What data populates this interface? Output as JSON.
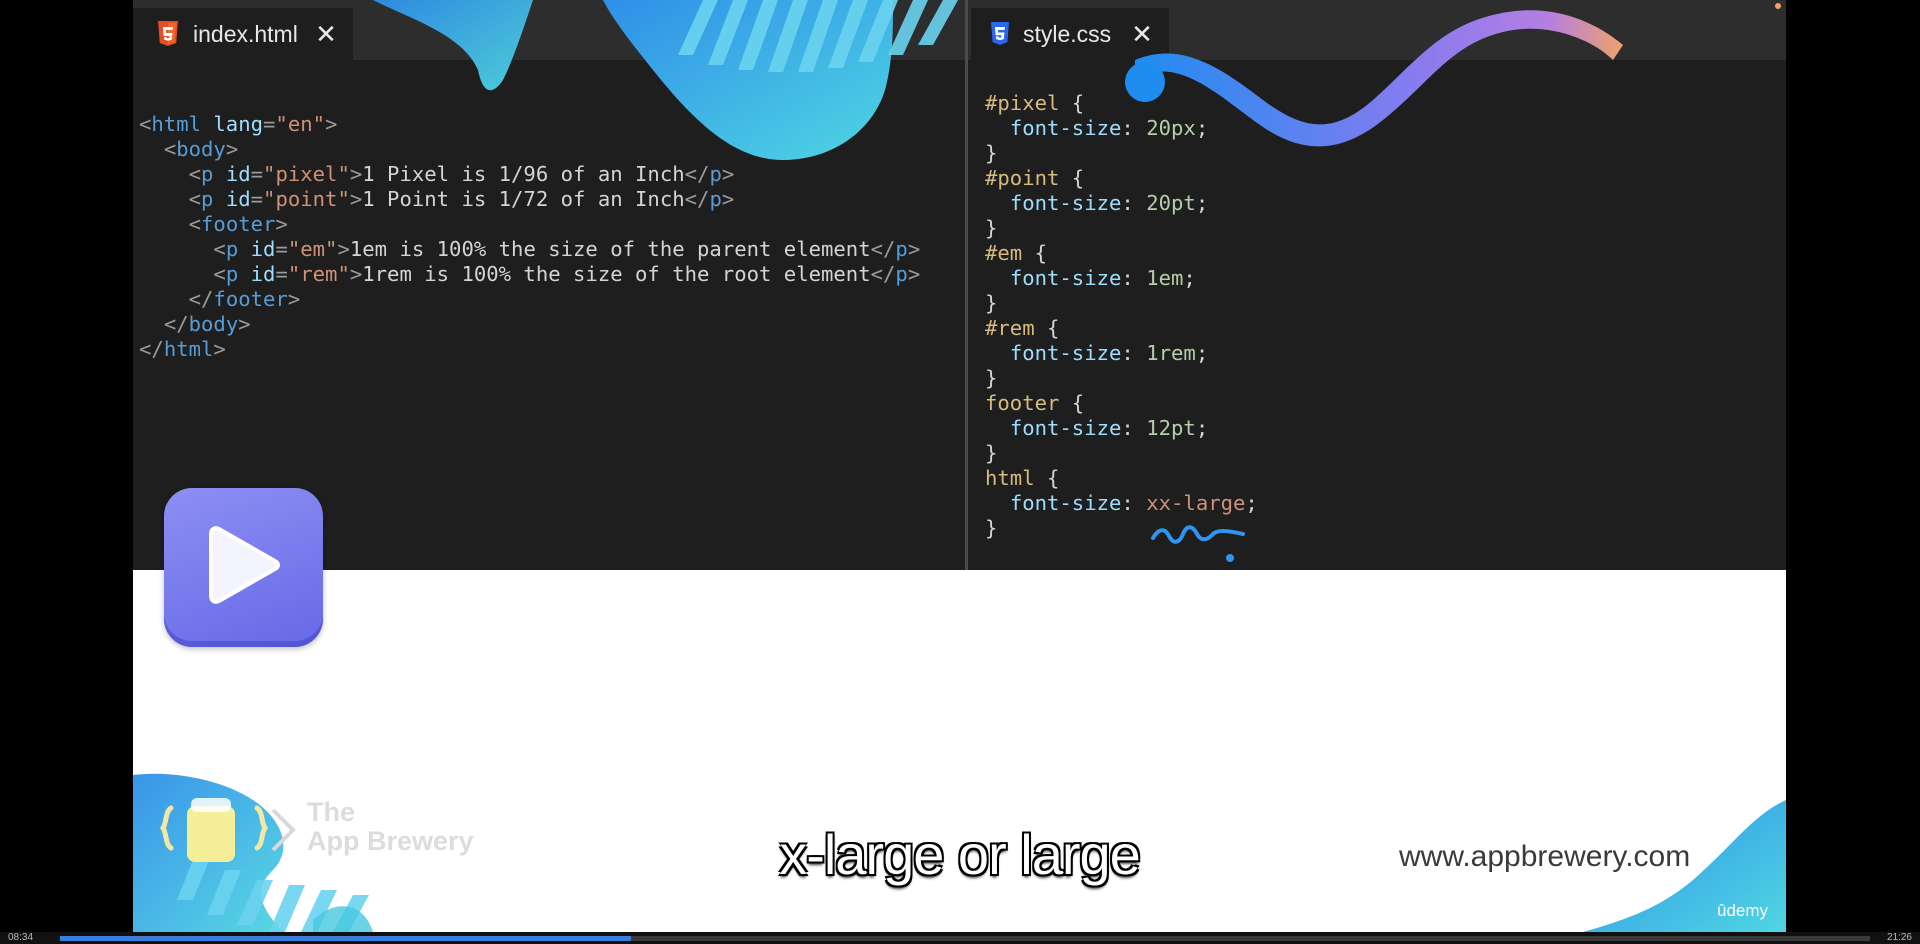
{
  "tabs": {
    "left": {
      "label": "index.html",
      "icon": "html5-icon",
      "close": "✕"
    },
    "right": {
      "label": "style.css",
      "icon": "css3-icon",
      "close": "✕"
    }
  },
  "html_code": [
    [
      [
        "punc",
        "<"
      ],
      [
        "tag",
        "html "
      ],
      [
        "attr",
        "lang"
      ],
      [
        "punc",
        "="
      ],
      [
        "str",
        "\"en\""
      ],
      [
        "punc",
        ">"
      ]
    ],
    [
      [
        "text",
        "  "
      ],
      [
        "punc",
        "<"
      ],
      [
        "tag",
        "body"
      ],
      [
        "punc",
        ">"
      ]
    ],
    [
      [
        "text",
        "    "
      ],
      [
        "punc",
        "<"
      ],
      [
        "tag",
        "p "
      ],
      [
        "attr",
        "id"
      ],
      [
        "punc",
        "="
      ],
      [
        "str",
        "\"pixel\""
      ],
      [
        "punc",
        ">"
      ],
      [
        "text",
        "1 Pixel is 1/96 of an Inch"
      ],
      [
        "punc",
        "</"
      ],
      [
        "tag",
        "p"
      ],
      [
        "punc",
        ">"
      ]
    ],
    [
      [
        "text",
        "    "
      ],
      [
        "punc",
        "<"
      ],
      [
        "tag",
        "p "
      ],
      [
        "attr",
        "id"
      ],
      [
        "punc",
        "="
      ],
      [
        "str",
        "\"point\""
      ],
      [
        "punc",
        ">"
      ],
      [
        "text",
        "1 Point is 1/72 of an Inch"
      ],
      [
        "punc",
        "</"
      ],
      [
        "tag",
        "p"
      ],
      [
        "punc",
        ">"
      ]
    ],
    [
      [
        "text",
        "    "
      ],
      [
        "punc",
        "<"
      ],
      [
        "tag",
        "footer"
      ],
      [
        "punc",
        ">"
      ]
    ],
    [
      [
        "text",
        "      "
      ],
      [
        "punc",
        "<"
      ],
      [
        "tag",
        "p "
      ],
      [
        "attr",
        "id"
      ],
      [
        "punc",
        "="
      ],
      [
        "str",
        "\"em\""
      ],
      [
        "punc",
        ">"
      ],
      [
        "text",
        "1em is 100% the size of the parent element"
      ],
      [
        "punc",
        "</"
      ],
      [
        "tag",
        "p"
      ],
      [
        "punc",
        ">"
      ]
    ],
    [
      [
        "text",
        "      "
      ],
      [
        "punc",
        "<"
      ],
      [
        "tag",
        "p "
      ],
      [
        "attr",
        "id"
      ],
      [
        "punc",
        "="
      ],
      [
        "str",
        "\"rem\""
      ],
      [
        "punc",
        ">"
      ],
      [
        "text",
        "1rem is 100% the size of the root element"
      ],
      [
        "punc",
        "</"
      ],
      [
        "tag",
        "p"
      ],
      [
        "punc",
        ">"
      ]
    ],
    [
      [
        "text",
        "    "
      ],
      [
        "punc",
        "</"
      ],
      [
        "tag",
        "footer"
      ],
      [
        "punc",
        ">"
      ]
    ],
    [
      [
        "text",
        "  "
      ],
      [
        "punc",
        "</"
      ],
      [
        "tag",
        "body"
      ],
      [
        "punc",
        ">"
      ]
    ],
    [
      [
        "punc",
        "</"
      ],
      [
        "tag",
        "html"
      ],
      [
        "punc",
        ">"
      ]
    ]
  ],
  "css_code": [
    [
      [
        "sel",
        "#pixel"
      ],
      [
        "white",
        " {"
      ]
    ],
    [
      [
        "white",
        "  "
      ],
      [
        "prop",
        "font-size"
      ],
      [
        "white",
        ": "
      ],
      [
        "num",
        "20px"
      ],
      [
        "white",
        ";"
      ]
    ],
    [
      [
        "white",
        "}"
      ]
    ],
    [
      [
        "sel",
        "#point"
      ],
      [
        "white",
        " {"
      ]
    ],
    [
      [
        "white",
        "  "
      ],
      [
        "prop",
        "font-size"
      ],
      [
        "white",
        ": "
      ],
      [
        "num",
        "20pt"
      ],
      [
        "white",
        ";"
      ]
    ],
    [
      [
        "white",
        "}"
      ]
    ],
    [
      [
        "sel",
        "#em"
      ],
      [
        "white",
        " {"
      ]
    ],
    [
      [
        "white",
        "  "
      ],
      [
        "prop",
        "font-size"
      ],
      [
        "white",
        ": "
      ],
      [
        "num",
        "1em"
      ],
      [
        "white",
        ";"
      ]
    ],
    [
      [
        "white",
        "}"
      ]
    ],
    [
      [
        "sel",
        "#rem"
      ],
      [
        "white",
        " {"
      ]
    ],
    [
      [
        "white",
        "  "
      ],
      [
        "prop",
        "font-size"
      ],
      [
        "white",
        ": "
      ],
      [
        "num",
        "1rem"
      ],
      [
        "white",
        ";"
      ]
    ],
    [
      [
        "white",
        "}"
      ]
    ],
    [
      [
        "sel",
        "footer"
      ],
      [
        "white",
        " {"
      ]
    ],
    [
      [
        "white",
        "  "
      ],
      [
        "prop",
        "font-size"
      ],
      [
        "white",
        ": "
      ],
      [
        "num",
        "12pt"
      ],
      [
        "white",
        ";"
      ]
    ],
    [
      [
        "white",
        "}"
      ]
    ],
    [
      [
        "sel",
        "html"
      ],
      [
        "white",
        " {"
      ]
    ],
    [
      [
        "white",
        "  "
      ],
      [
        "prop",
        "font-size"
      ],
      [
        "white",
        ": "
      ],
      [
        "str",
        "xx-large"
      ],
      [
        "white",
        ";"
      ]
    ],
    [
      [
        "white",
        "}"
      ]
    ]
  ],
  "play_button": {
    "icon": "play-icon"
  },
  "branding": {
    "logo_line1": "The",
    "logo_line2": "App Brewery",
    "url": "www.appbrewery.com",
    "udemy": "ûdemy"
  },
  "subtitle": "x-large or large",
  "player": {
    "elapsed": "08:34",
    "total": "21:26",
    "progress_fraction": 0.3154
  },
  "colors": {
    "editor_bg": "#1e1e1e",
    "accent_blue": "#3b7ddd",
    "teal": "#45c8e0",
    "play_purple": "#7679ec"
  }
}
